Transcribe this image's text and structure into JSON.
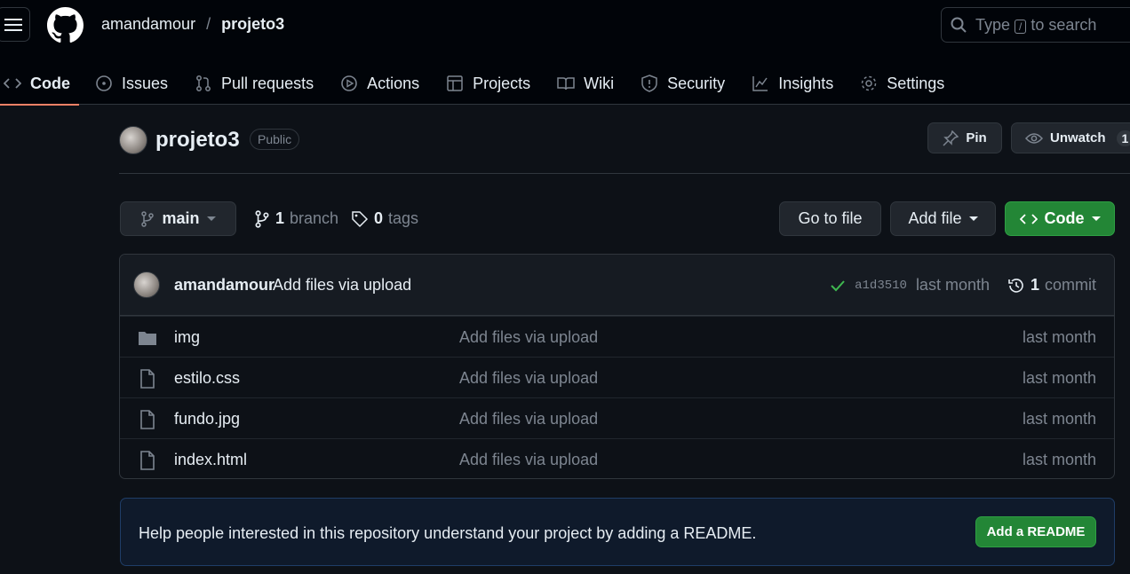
{
  "header": {
    "owner": "amandamour",
    "separator": "/",
    "repo": "projeto3",
    "search_prefix": "Type",
    "search_key": "/",
    "search_suffix": "to search"
  },
  "tabs": [
    {
      "label": "Code",
      "icon": "code-icon",
      "active": true
    },
    {
      "label": "Issues",
      "icon": "issue-icon"
    },
    {
      "label": "Pull requests",
      "icon": "pull-request-icon"
    },
    {
      "label": "Actions",
      "icon": "play-icon"
    },
    {
      "label": "Projects",
      "icon": "table-icon"
    },
    {
      "label": "Wiki",
      "icon": "book-icon"
    },
    {
      "label": "Security",
      "icon": "shield-icon"
    },
    {
      "label": "Insights",
      "icon": "graph-icon"
    },
    {
      "label": "Settings",
      "icon": "gear-icon"
    }
  ],
  "repohead": {
    "title": "projeto3",
    "visibility": "Public",
    "pin_label": "Pin",
    "unwatch_label": "Unwatch",
    "watch_count": "1"
  },
  "toolbar": {
    "branch": "main",
    "branch_count": "1",
    "branch_label": "branch",
    "tag_count": "0",
    "tag_label": "tags",
    "goto_file": "Go to file",
    "add_file": "Add file",
    "code": "Code"
  },
  "commit": {
    "author": "amandamour",
    "message": "Add files via upload",
    "sha": "a1d3510",
    "time": "last month",
    "commit_count": "1",
    "commit_label": "commit"
  },
  "files": [
    {
      "name": "img",
      "type": "folder",
      "message": "Add files via upload",
      "time": "last month"
    },
    {
      "name": "estilo.css",
      "type": "file",
      "message": "Add files via upload",
      "time": "last month"
    },
    {
      "name": "fundo.jpg",
      "type": "file",
      "message": "Add files via upload",
      "time": "last month"
    },
    {
      "name": "index.html",
      "type": "file",
      "message": "Add files via upload",
      "time": "last month"
    }
  ],
  "readme": {
    "text": "Help people interested in this repository understand your project by adding a README.",
    "button": "Add a README"
  },
  "colors": {
    "accent_green": "#238636",
    "tab_underline": "#f78166",
    "background": "#0d1117"
  }
}
